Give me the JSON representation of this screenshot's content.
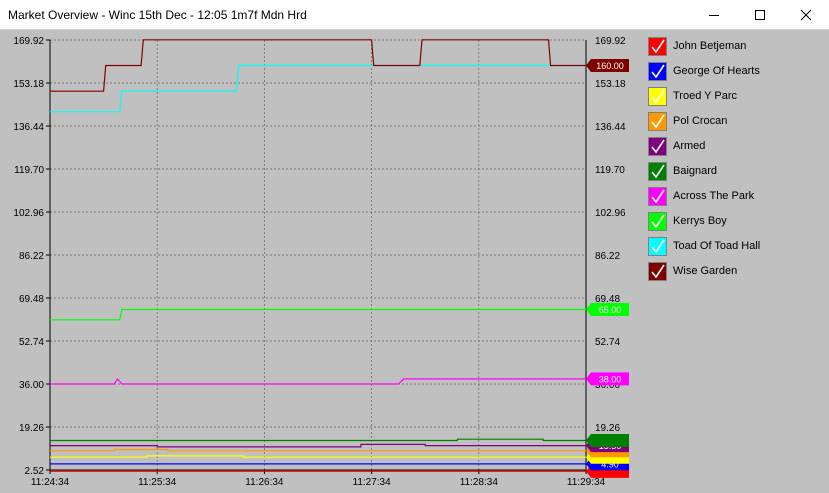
{
  "window": {
    "title": "Market Overview - Winc  15th Dec - 12:05 1m7f Mdn Hrd",
    "minimize_icon": "minimize-icon",
    "maximize_icon": "maximize-icon",
    "close_icon": "close-icon"
  },
  "chart_data": {
    "type": "line",
    "yticks": [
      "169.92",
      "153.18",
      "136.44",
      "119.70",
      "102.96",
      "86.22",
      "69.48",
      "52.74",
      "36.00",
      "19.26",
      "2.52"
    ],
    "ylim": [
      2.52,
      169.92
    ],
    "xticks": [
      "11:24:34",
      "11:25:34",
      "11:26:34",
      "11:27:34",
      "11:28:34",
      "11:29:34"
    ],
    "grid": true,
    "legend_position": "right",
    "series": [
      {
        "name": "John Betjeman",
        "color": "#ff0000",
        "label": "",
        "points": [
          [
            0,
            2.0
          ],
          [
            5,
            2.0
          ]
        ]
      },
      {
        "name": "George Of Hearts",
        "color": "#0000ff",
        "label": "4.90",
        "points": [
          [
            0,
            4.9
          ],
          [
            5,
            4.9
          ]
        ]
      },
      {
        "name": "Troed Y Parc",
        "color": "#ffff00",
        "label": "",
        "points": [
          [
            0,
            7.5
          ],
          [
            0.9,
            7.5
          ],
          [
            0.9,
            8.0
          ],
          [
            1.8,
            8.0
          ],
          [
            1.8,
            7.5
          ],
          [
            5,
            7.5
          ]
        ]
      },
      {
        "name": "Pol Crocan",
        "color": "#ff9900",
        "label": "",
        "points": [
          [
            0,
            10.0
          ],
          [
            0.6,
            10.0
          ],
          [
            0.6,
            10.5
          ],
          [
            1.1,
            10.5
          ],
          [
            1.1,
            10.0
          ],
          [
            5,
            10.0
          ]
        ]
      },
      {
        "name": "Armed",
        "color": "#800080",
        "label": "13.50",
        "points": [
          [
            0,
            12.0
          ],
          [
            1.0,
            12.0
          ],
          [
            1.0,
            11.5
          ],
          [
            2.9,
            11.5
          ],
          [
            2.9,
            12.5
          ],
          [
            3.5,
            12.5
          ],
          [
            3.5,
            12.0
          ],
          [
            5,
            12.0
          ]
        ]
      },
      {
        "name": "Baignard",
        "color": "#008000",
        "label": "",
        "points": [
          [
            0,
            14.0
          ],
          [
            3.8,
            14.0
          ],
          [
            3.8,
            14.5
          ],
          [
            4.6,
            14.5
          ],
          [
            4.6,
            14.0
          ],
          [
            5,
            14.0
          ]
        ]
      },
      {
        "name": "Across The Park",
        "color": "#ff00ff",
        "label": "38.00",
        "points": [
          [
            0,
            36.0
          ],
          [
            0.6,
            36.0
          ],
          [
            0.63,
            38.0
          ],
          [
            0.67,
            36.0
          ],
          [
            3.25,
            36.0
          ],
          [
            3.3,
            38.0
          ],
          [
            5,
            38.0
          ]
        ]
      },
      {
        "name": "Kerrys Boy",
        "color": "#00ff00",
        "label": "65.00",
        "points": [
          [
            0,
            61.0
          ],
          [
            0.65,
            61.0
          ],
          [
            0.67,
            65.0
          ],
          [
            5,
            65.0
          ]
        ]
      },
      {
        "name": "Toad Of Toad Hall",
        "color": "#00ffff",
        "label": "",
        "points": [
          [
            0,
            142.0
          ],
          [
            0.65,
            142.0
          ],
          [
            0.67,
            150.0
          ],
          [
            1.74,
            150.0
          ],
          [
            1.76,
            160.0
          ],
          [
            5,
            160.0
          ]
        ]
      },
      {
        "name": "Wise Garden",
        "color": "#800000",
        "label": "160.00",
        "points": [
          [
            0,
            150.0
          ],
          [
            0.5,
            150.0
          ],
          [
            0.52,
            160.0
          ],
          [
            0.85,
            160.0
          ],
          [
            0.87,
            170.0
          ],
          [
            3.0,
            170.0
          ],
          [
            3.02,
            160.0
          ],
          [
            3.45,
            160.0
          ],
          [
            3.47,
            170.0
          ],
          [
            4.65,
            170.0
          ],
          [
            4.67,
            160.0
          ],
          [
            5,
            160.0
          ]
        ]
      }
    ]
  }
}
